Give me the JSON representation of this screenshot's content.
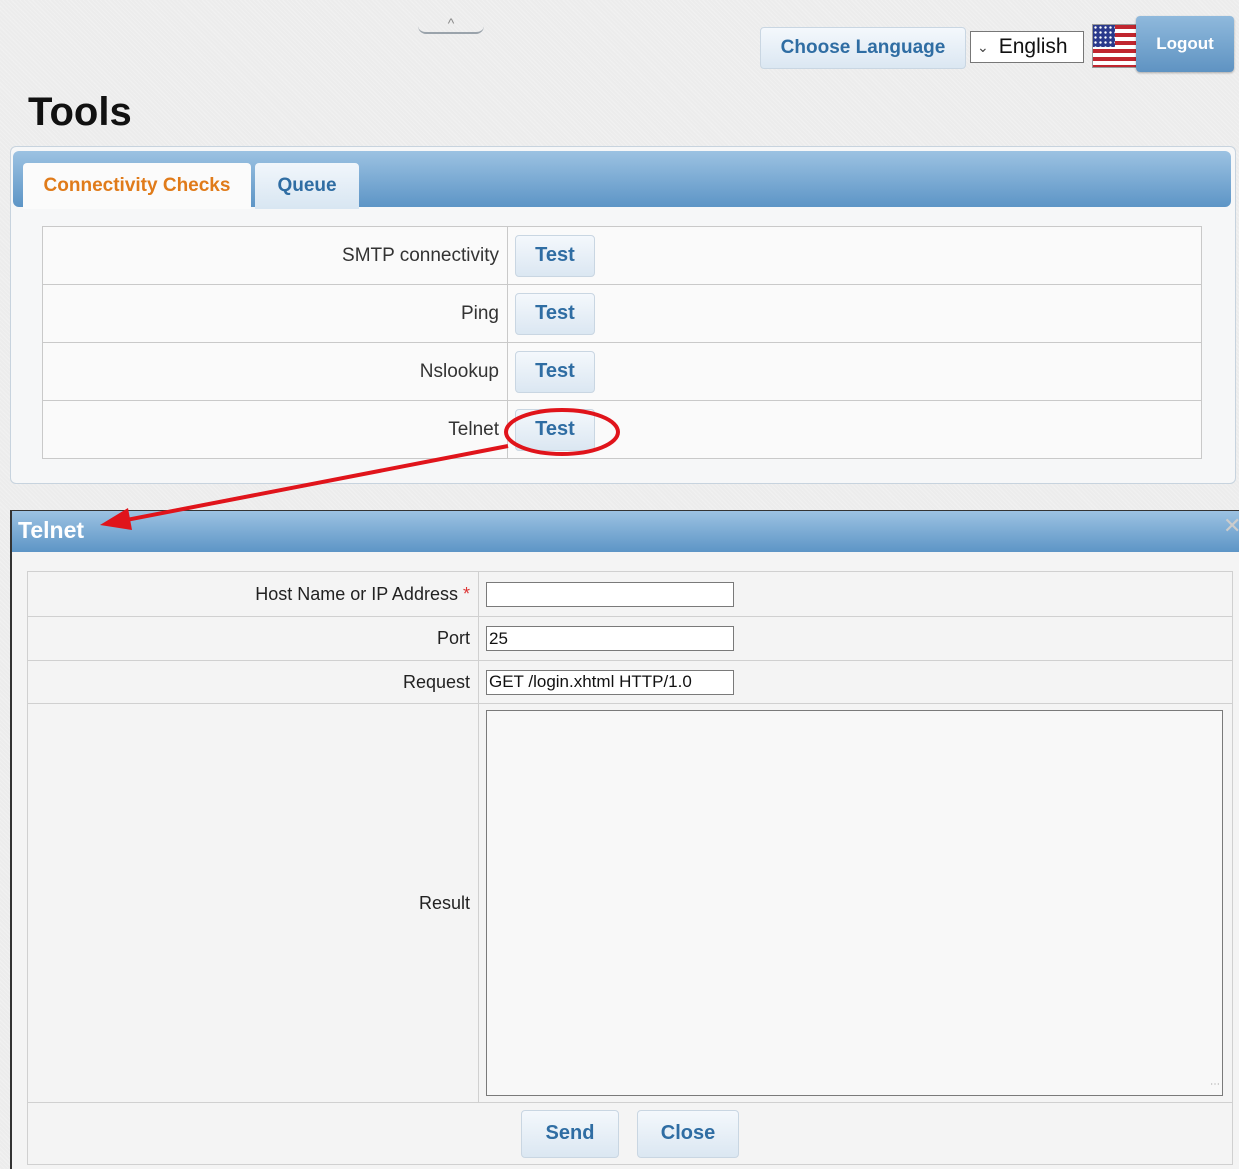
{
  "header": {
    "collapse_glyph": "^",
    "choose_language_label": "Choose Language",
    "language_selected": "English",
    "logout_label": "Logout"
  },
  "page": {
    "title": "Tools"
  },
  "tabs": [
    {
      "label": "Connectivity Checks",
      "active": true
    },
    {
      "label": "Queue",
      "active": false
    }
  ],
  "checks": [
    {
      "label": "SMTP connectivity",
      "button": "Test"
    },
    {
      "label": "Ping",
      "button": "Test"
    },
    {
      "label": "Nslookup",
      "button": "Test"
    },
    {
      "label": "Telnet",
      "button": "Test"
    }
  ],
  "dialog": {
    "title": "Telnet",
    "host_label": "Host Name or IP Address",
    "required_marker": "*",
    "host_value": "",
    "port_label": "Port",
    "port_value": "25",
    "request_label": "Request",
    "request_value": "GET /login.xhtml HTTP/1.0",
    "result_label": "Result",
    "result_value": "",
    "send_label": "Send",
    "close_label": "Close"
  },
  "colors": {
    "accent": "#2f6da3",
    "active_tab_text": "#e07b1a",
    "annotation": "#e0141b"
  },
  "icons": {
    "collapse": "chevron-up-icon",
    "dropdown": "chevron-down-icon",
    "flag": "us-flag-icon",
    "close": "close-icon",
    "grip": "resize-grip-icon"
  }
}
